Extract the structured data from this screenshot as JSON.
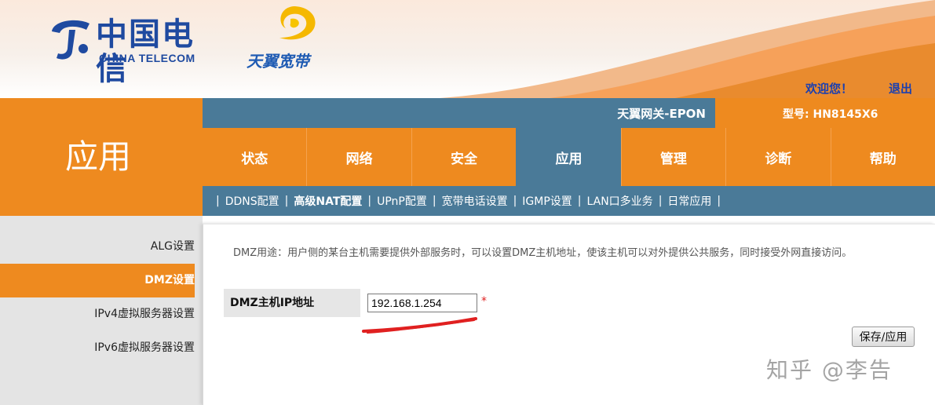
{
  "header": {
    "brand_cn": "中国电信",
    "brand_en": "CHINA TELECOM",
    "product_cn": "天翼宽带",
    "welcome": "欢迎您！",
    "logout": "退出"
  },
  "section_title": "应用",
  "gateway_title": "天翼网关-EPON",
  "model_label": "型号: HN8145X6",
  "tabs": [
    {
      "label": "状态"
    },
    {
      "label": "网络"
    },
    {
      "label": "安全"
    },
    {
      "label": "应用"
    },
    {
      "label": "管理"
    },
    {
      "label": "诊断"
    },
    {
      "label": "帮助"
    }
  ],
  "subnav": {
    "items": [
      "DDNS配置",
      "高级NAT配置",
      "UPnP配置",
      "宽带电话设置",
      "IGMP设置",
      "LAN口多业务",
      "日常应用"
    ],
    "current": "高级NAT配置"
  },
  "sidebar": {
    "items": [
      "ALG设置",
      "DMZ设置",
      "IPv4虚拟服务器设置",
      "IPv6虚拟服务器设置"
    ],
    "active": "DMZ设置"
  },
  "content": {
    "description": "DMZ用途：用户侧的某台主机需要提供外部服务时，可以设置DMZ主机地址，使该主机可以对外提供公共服务，同时接受外网直接访问。",
    "field_label": "DMZ主机IP地址",
    "ip_value": "192.168.1.254",
    "required_mark": "*",
    "save_label": "保存/应用"
  },
  "watermark": "知乎 @李告",
  "colors": {
    "orange": "#ee8a1f",
    "steel_blue": "#4a7a98",
    "brand_blue": "#1f4aa0",
    "annotation_red": "#e02020"
  }
}
